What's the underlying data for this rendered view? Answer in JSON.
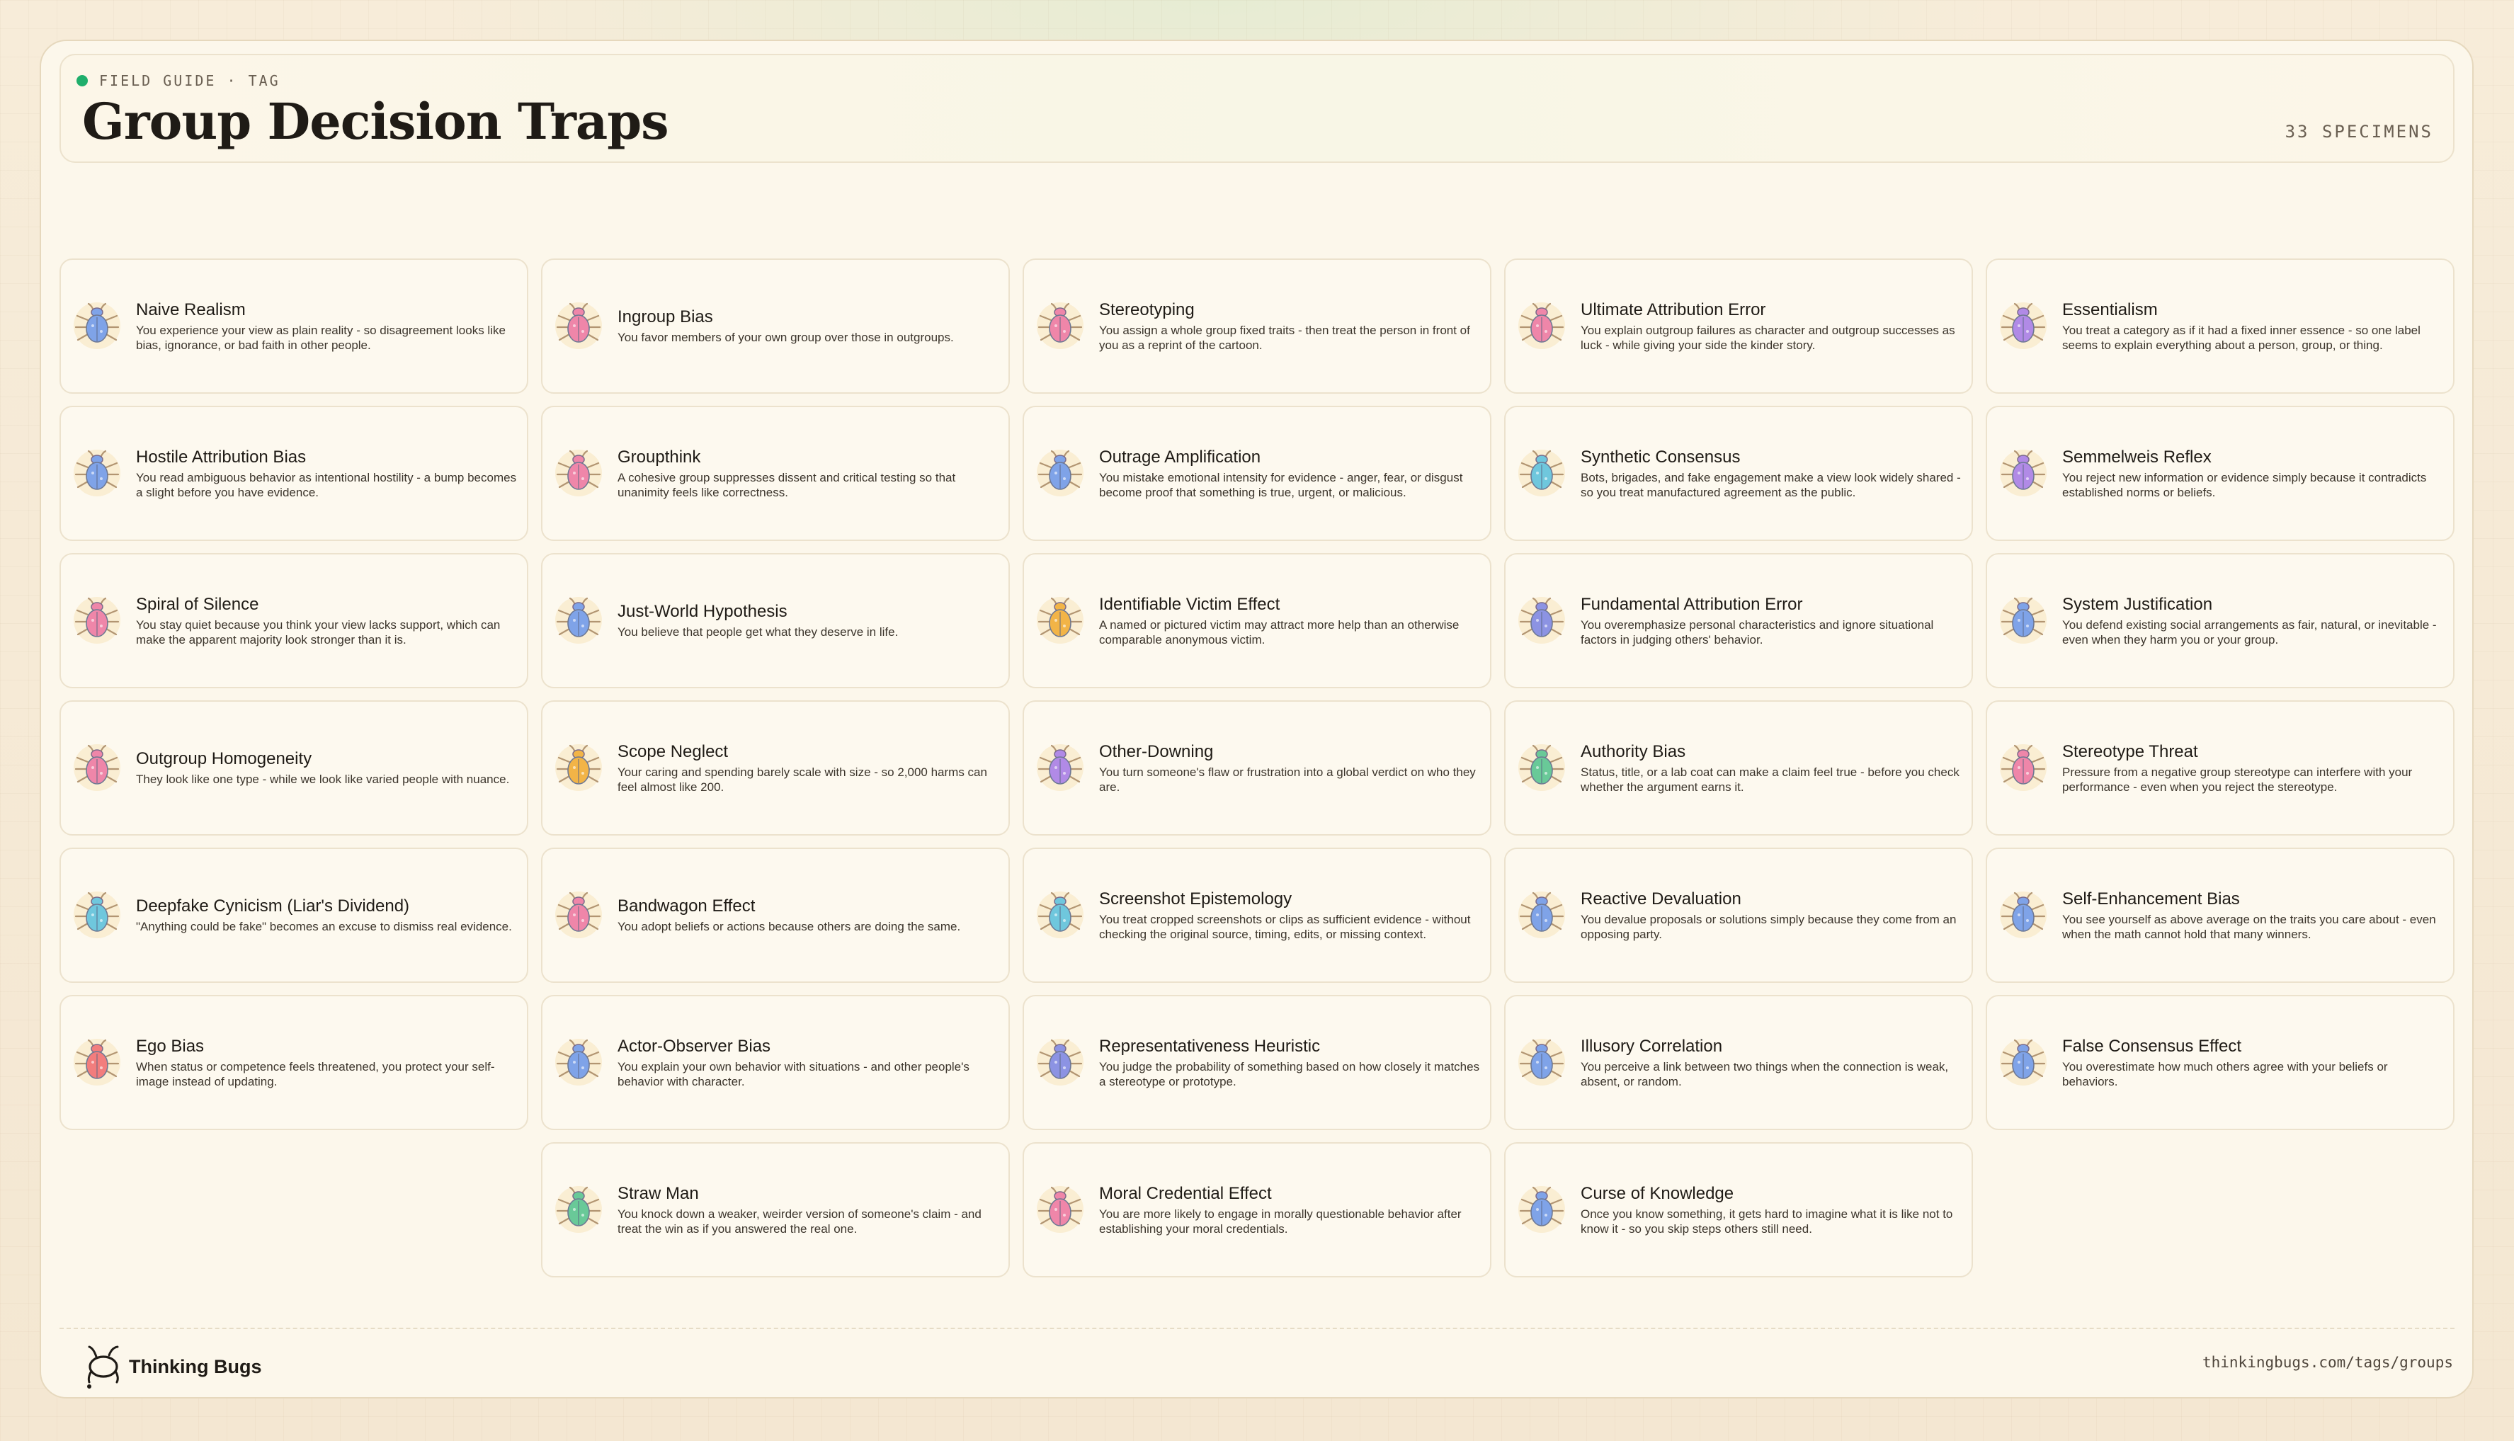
{
  "header": {
    "kicker": "FIELD GUIDE · TAG",
    "title": "Group Decision Traps",
    "count": "33 SPECIMENS"
  },
  "palette": {
    "blue": "#7fa3e8",
    "pink": "#ef86a9",
    "purple": "#b18ae6",
    "cyan": "#6fc7dd",
    "orange": "#f2b447",
    "green": "#69c998",
    "red": "#f27d7d",
    "indigo": "#8c93e3"
  },
  "cards": [
    {
      "name": "Naive Realism",
      "desc": "You experience your view as plain reality - so disagreement looks like bias, ignorance, or bad faith in other people.",
      "bug_color": "blue"
    },
    {
      "name": "Ingroup Bias",
      "desc": "You favor members of your own group over those in outgroups.",
      "bug_color": "pink"
    },
    {
      "name": "Stereotyping",
      "desc": "You assign a whole group fixed traits - then treat the person in front of you as a reprint of the cartoon.",
      "bug_color": "pink"
    },
    {
      "name": "Ultimate Attribution Error",
      "desc": "You explain outgroup failures as character and outgroup successes as luck - while giving your side the kinder story.",
      "bug_color": "pink"
    },
    {
      "name": "Essentialism",
      "desc": "You treat a category as if it had a fixed inner essence - so one label seems to explain everything about a person, group, or thing.",
      "bug_color": "purple"
    },
    {
      "name": "Hostile Attribution Bias",
      "desc": "You read ambiguous behavior as intentional hostility - a bump becomes a slight before you have evidence.",
      "bug_color": "blue"
    },
    {
      "name": "Groupthink",
      "desc": "A cohesive group suppresses dissent and critical testing so that unanimity feels like correctness.",
      "bug_color": "pink"
    },
    {
      "name": "Outrage Amplification",
      "desc": "You mistake emotional intensity for evidence - anger, fear, or disgust become proof that something is true, urgent, or malicious.",
      "bug_color": "blue"
    },
    {
      "name": "Synthetic Consensus",
      "desc": "Bots, brigades, and fake engagement make a view look widely shared - so you treat manufactured agreement as the public.",
      "bug_color": "cyan"
    },
    {
      "name": "Semmelweis Reflex",
      "desc": "You reject new information or evidence simply because it contradicts established norms or beliefs.",
      "bug_color": "purple"
    },
    {
      "name": "Spiral of Silence",
      "desc": "You stay quiet because you think your view lacks support, which can make the apparent majority look stronger than it is.",
      "bug_color": "pink"
    },
    {
      "name": "Just-World Hypothesis",
      "desc": "You believe that people get what they deserve in life.",
      "bug_color": "blue"
    },
    {
      "name": "Identifiable Victim Effect",
      "desc": "A named or pictured victim may attract more help than an otherwise comparable anonymous victim.",
      "bug_color": "orange"
    },
    {
      "name": "Fundamental Attribution Error",
      "desc": "You overemphasize personal characteristics and ignore situational factors in judging others' behavior.",
      "bug_color": "indigo"
    },
    {
      "name": "System Justification",
      "desc": "You defend existing social arrangements as fair, natural, or inevitable - even when they harm you or your group.",
      "bug_color": "blue"
    },
    {
      "name": "Outgroup Homogeneity",
      "desc": "They look like one type - while we look like varied people with nuance.",
      "bug_color": "pink"
    },
    {
      "name": "Scope Neglect",
      "desc": "Your caring and spending barely scale with size - so 2,000 harms can feel almost like 200.",
      "bug_color": "orange"
    },
    {
      "name": "Other-Downing",
      "desc": "You turn someone's flaw or frustration into a global verdict on who they are.",
      "bug_color": "purple"
    },
    {
      "name": "Authority Bias",
      "desc": "Status, title, or a lab coat can make a claim feel true - before you check whether the argument earns it.",
      "bug_color": "green"
    },
    {
      "name": "Stereotype Threat",
      "desc": "Pressure from a negative group stereotype can interfere with your performance - even when you reject the stereotype.",
      "bug_color": "pink"
    },
    {
      "name": "Deepfake Cynicism (Liar's Dividend)",
      "desc": "\"Anything could be fake\" becomes an excuse to dismiss real evidence.",
      "bug_color": "cyan"
    },
    {
      "name": "Bandwagon Effect",
      "desc": "You adopt beliefs or actions because others are doing the same.",
      "bug_color": "pink"
    },
    {
      "name": "Screenshot Epistemology",
      "desc": "You treat cropped screenshots or clips as sufficient evidence - without checking the original source, timing, edits, or missing context.",
      "bug_color": "cyan"
    },
    {
      "name": "Reactive Devaluation",
      "desc": "You devalue proposals or solutions simply because they come from an opposing party.",
      "bug_color": "blue"
    },
    {
      "name": "Self-Enhancement Bias",
      "desc": "You see yourself as above average on the traits you care about - even when the math cannot hold that many winners.",
      "bug_color": "blue"
    },
    {
      "name": "Ego Bias",
      "desc": "When status or competence feels threatened, you protect your self-image instead of updating.",
      "bug_color": "red"
    },
    {
      "name": "Actor-Observer Bias",
      "desc": "You explain your own behavior with situations - and other people's behavior with character.",
      "bug_color": "blue"
    },
    {
      "name": "Representativeness Heuristic",
      "desc": "You judge the probability of something based on how closely it matches a stereotype or prototype.",
      "bug_color": "indigo"
    },
    {
      "name": "Illusory Correlation",
      "desc": "You perceive a link between two things when the connection is weak, absent, or random.",
      "bug_color": "blue"
    },
    {
      "name": "False Consensus Effect",
      "desc": "You overestimate how much others agree with your beliefs or behaviors.",
      "bug_color": "blue"
    },
    {
      "name": "Straw Man",
      "desc": "You knock down a weaker, weirder version of someone's claim - and treat the win as if you answered the real one.",
      "bug_color": "green"
    },
    {
      "name": "Moral Credential Effect",
      "desc": "You are more likely to engage in morally questionable behavior after establishing your moral credentials.",
      "bug_color": "pink"
    },
    {
      "name": "Curse of Knowledge",
      "desc": "Once you know something, it gets hard to imagine what it is like not to know it - so you skip steps others still need.",
      "bug_color": "blue"
    }
  ],
  "footer": {
    "brand": "Thinking Bugs",
    "url": "thinkingbugs.com/tags/groups"
  }
}
